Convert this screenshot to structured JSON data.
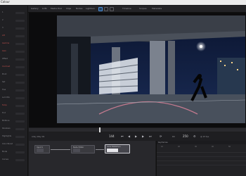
{
  "app": {
    "name": "Colour"
  },
  "toolbar": {
    "items": [
      "Gallery",
      "LUTs",
      "Media Pool",
      "Clips",
      "Nodes",
      "Lightbox",
      "Timeline",
      "Scopes",
      "Metadata"
    ],
    "icons": [
      "layout-icon",
      "highlight-icon",
      "grid-icon"
    ]
  },
  "left_panel": {
    "rows": [
      {
        "label": "1",
        "red": false
      },
      {
        "label": "2",
        "red": false
      },
      {
        "label": "3",
        "red": false
      },
      {
        "label": "Lift",
        "red": true
      },
      {
        "label": "Gamma",
        "red": true
      },
      {
        "label": "Gain",
        "red": true
      },
      {
        "label": "Offset",
        "red": false
      },
      {
        "label": "Contrast",
        "red": true
      },
      {
        "label": "Pivot",
        "red": false
      },
      {
        "label": "Sat",
        "red": false
      },
      {
        "label": "Hue",
        "red": false
      },
      {
        "label": "Lum Mix",
        "red": false
      },
      {
        "label": "Temp",
        "red": true
      },
      {
        "label": "Tint",
        "red": false
      },
      {
        "label": "Midtone",
        "red": false
      },
      {
        "label": "Shadows",
        "red": false
      },
      {
        "label": "Highlights",
        "red": false
      },
      {
        "label": "Color Boost",
        "red": false
      },
      {
        "label": "Mode",
        "red": false
      },
      {
        "label": "Curves",
        "red": false
      }
    ]
  },
  "transport": {
    "clip_name": "Alley Way 09",
    "frame": "144",
    "end_frame": "250",
    "fps": "@ 25 fps"
  },
  "nodes": [
    {
      "label": "Input 1"
    },
    {
      "label": "Node Editor"
    },
    {
      "label": "Lens Distortion"
    }
  ],
  "keyframes": {
    "title": "Keyframes",
    "ticks": [
      "10",
      "20",
      "30",
      "40",
      "50"
    ]
  },
  "colors": {
    "accent": "#4a8bd6",
    "warning": "#c0504d"
  }
}
